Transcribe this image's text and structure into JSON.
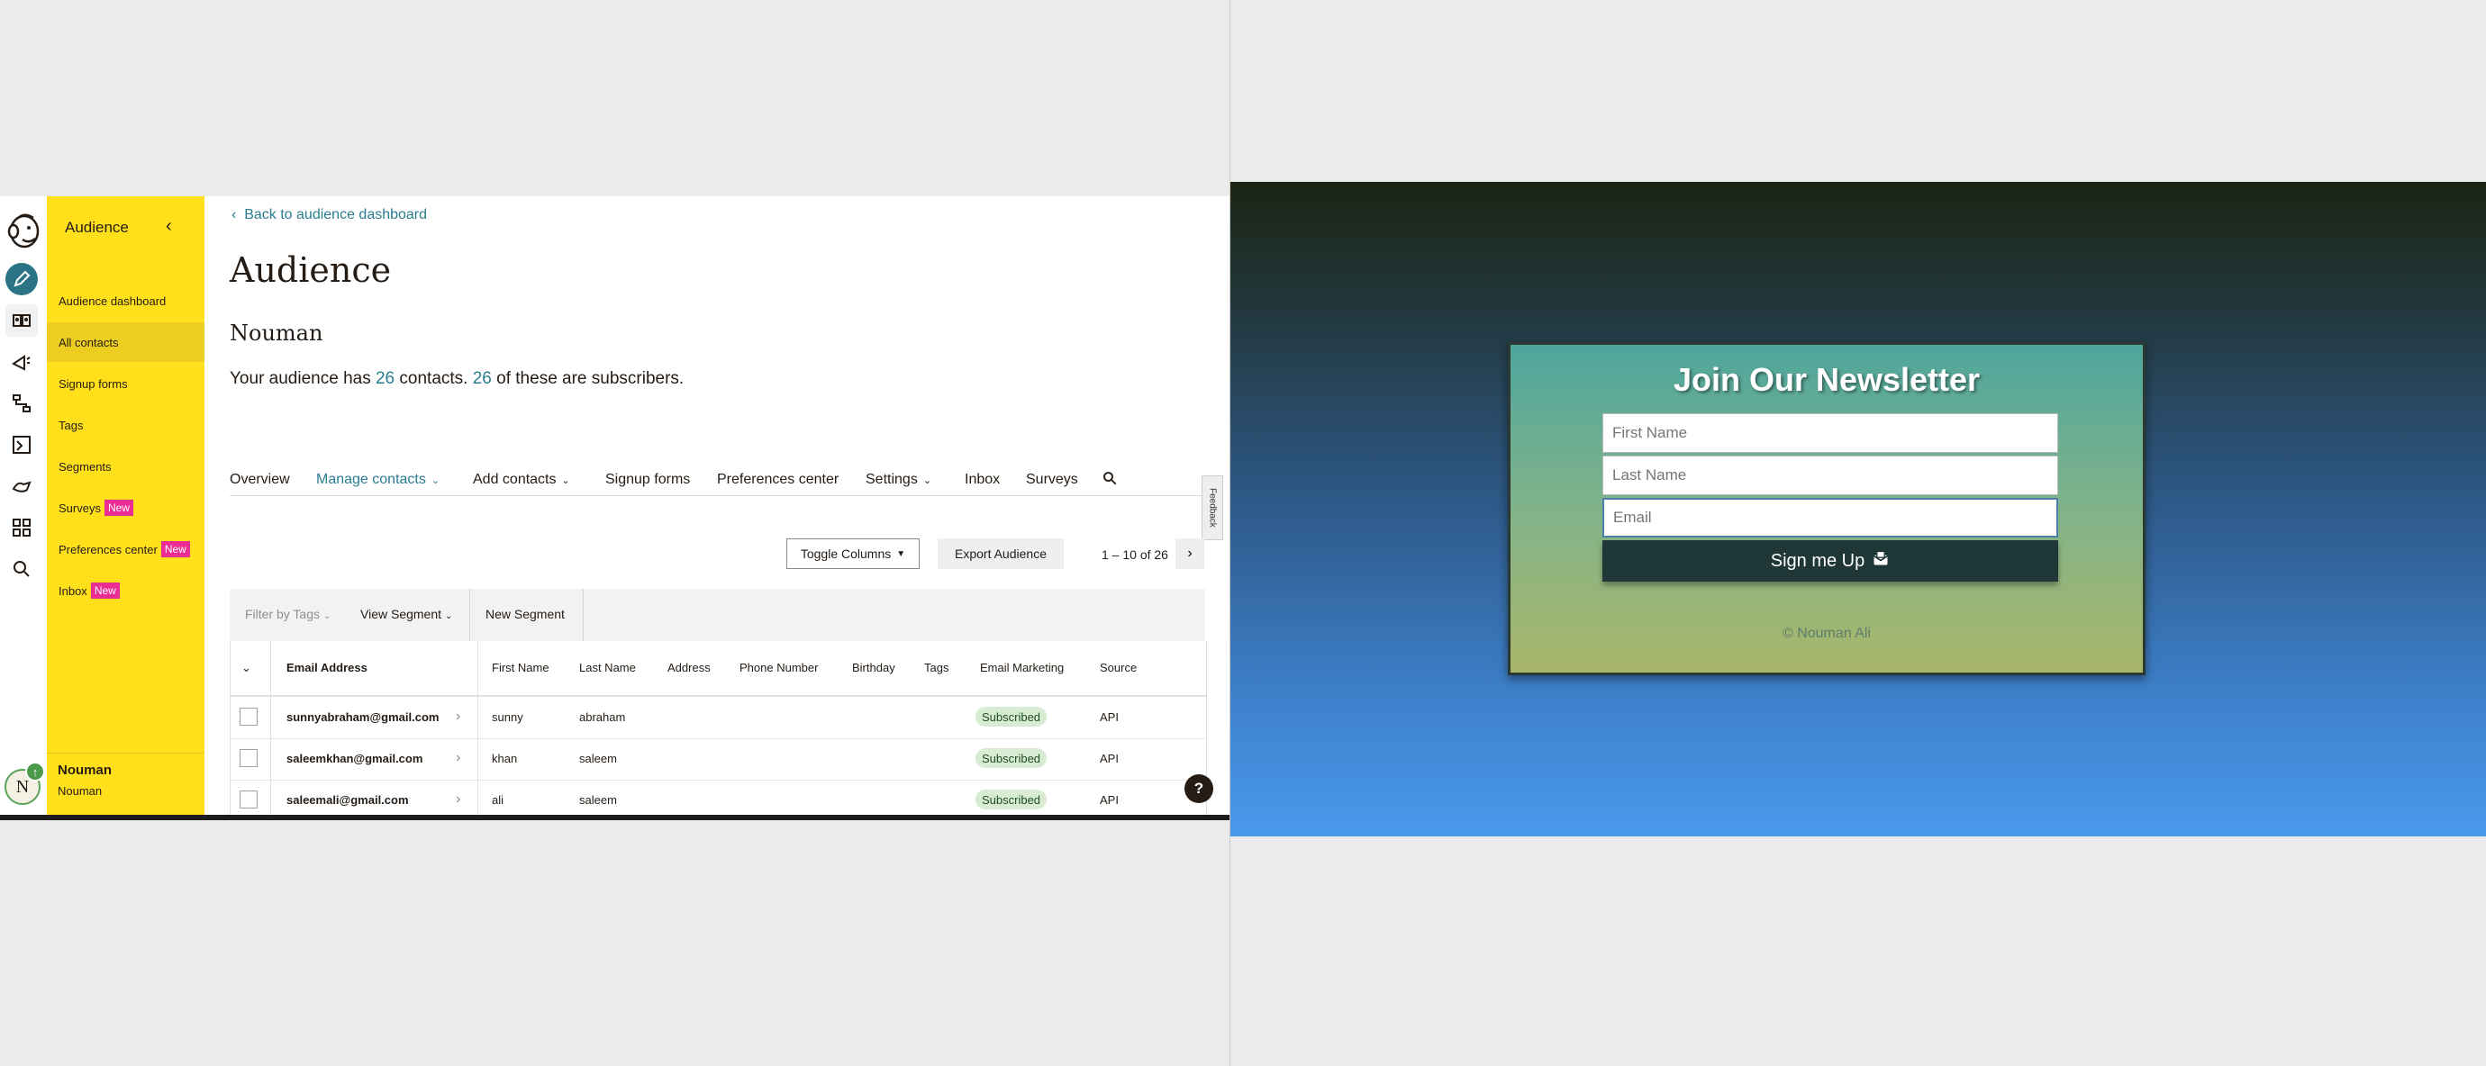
{
  "sidebar": {
    "title": "Audience",
    "items": [
      {
        "label": "Audience dashboard",
        "badge": ""
      },
      {
        "label": "All contacts",
        "badge": ""
      },
      {
        "label": "Signup forms",
        "badge": ""
      },
      {
        "label": "Tags",
        "badge": ""
      },
      {
        "label": "Segments",
        "badge": ""
      },
      {
        "label": "Surveys",
        "badge": "New"
      },
      {
        "label": "Preferences center",
        "badge": "New"
      },
      {
        "label": "Inbox",
        "badge": "New"
      }
    ],
    "user_name": "Nouman",
    "user_sub": "Nouman",
    "avatar_initial": "N"
  },
  "main": {
    "back_link": "Back to audience dashboard",
    "title": "Audience",
    "audience_name": "Nouman",
    "summary_prefix": "Your audience has ",
    "contacts_count": "26",
    "summary_mid": " contacts. ",
    "subscribers_count": "26",
    "summary_suffix": " of these are subscribers.",
    "tabs": [
      "Overview",
      "Manage contacts",
      "Add contacts",
      "Signup forms",
      "Preferences center",
      "Settings",
      "Inbox",
      "Surveys"
    ],
    "feedback_label": "Feedback",
    "toggle_columns": "Toggle Columns",
    "export_label": "Export Audience",
    "paging": "1 – 10 of 26",
    "filter_tags": "Filter by Tags",
    "view_segment": "View Segment",
    "new_segment": "New Segment",
    "help": "?"
  },
  "table": {
    "headers": [
      "Email Address",
      "First Name",
      "Last Name",
      "Address",
      "Phone Number",
      "Birthday",
      "Tags",
      "Email Marketing",
      "Source"
    ],
    "rows": [
      {
        "email": "sunnyabraham@gmail.com",
        "first": "sunny",
        "last": "abraham",
        "status": "Subscribed",
        "source": "API"
      },
      {
        "email": "saleemkhan@gmail.com",
        "first": "khan",
        "last": "saleem",
        "status": "Subscribed",
        "source": "API"
      },
      {
        "email": "saleemali@gmail.com",
        "first": "ali",
        "last": "saleem",
        "status": "Subscribed",
        "source": "API"
      }
    ]
  },
  "newsletter": {
    "title": "Join Our Newsletter",
    "first_placeholder": "First Name",
    "last_placeholder": "Last Name",
    "email_placeholder": "Email",
    "button_label": "Sign me Up",
    "footer": "© Nouman Ali"
  },
  "colors": {
    "sidebar": "#ffe01b",
    "link": "#2a7d90",
    "badge_new": "#eb2c92",
    "nl_button": "#1f3737"
  }
}
